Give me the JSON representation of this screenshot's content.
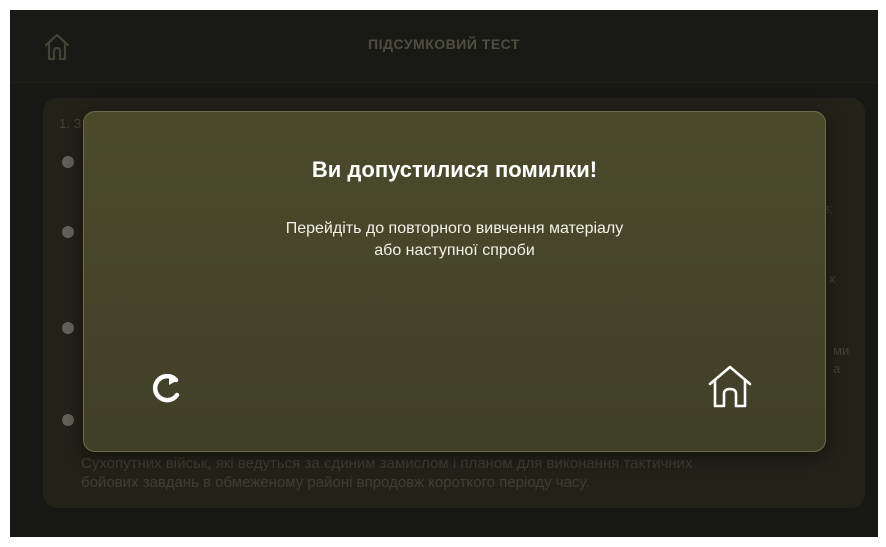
{
  "header": {
    "title": "ПІДСУМКОВИЙ ТЕСТ",
    "home_icon": "home-icon"
  },
  "background": {
    "question_number": "1. З",
    "fragments": [
      "в;",
      "х",
      "ми",
      "а"
    ],
    "answer_text_line1": "Сухопутних військ, які ведуться за єдиним замислом і планом для виконання тактичних",
    "answer_text_line2": "бойових завдань в обмеженому районі впродовж короткого періоду часу."
  },
  "modal": {
    "title": "Ви допустилися помилки!",
    "message_line1": "Перейдіть до повторного вивчення матеріалу",
    "message_line2": "або наступної спроби",
    "retry_icon": "retry-icon",
    "home_icon": "home-icon"
  },
  "colors": {
    "modal_bg": "#4a4a2b",
    "app_bg": "#1a1a17"
  }
}
